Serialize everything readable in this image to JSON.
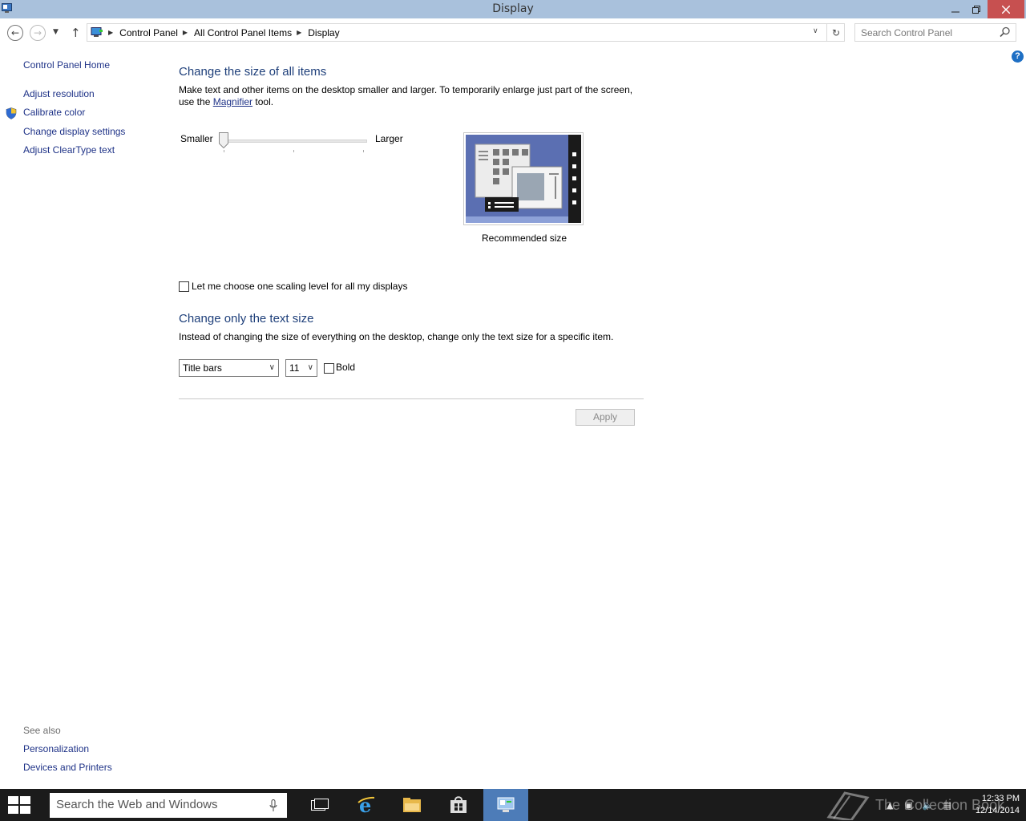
{
  "window": {
    "title": "Display",
    "minimize_icon": "minimize-icon",
    "maximize_icon": "restore-icon",
    "close_icon": "close-icon"
  },
  "navbar": {
    "breadcrumbs": [
      "Control Panel",
      "All Control Panel Items",
      "Display"
    ],
    "search_placeholder": "Search Control Panel"
  },
  "sidebar": {
    "home": "Control Panel Home",
    "items": [
      {
        "label": "Adjust resolution"
      },
      {
        "label": "Calibrate color"
      },
      {
        "label": "Change display settings"
      },
      {
        "label": "Adjust ClearType text"
      }
    ],
    "see_also_label": "See also",
    "see_also": [
      {
        "label": "Personalization"
      },
      {
        "label": "Devices and Printers"
      }
    ]
  },
  "main": {
    "heading_size": "Change the size of all items",
    "desc_line1": "Make text and other items on the desktop smaller and larger. To temporarily enlarge just part of the screen,",
    "desc_line2_prefix": "use the ",
    "magnifier_link": "Magnifier",
    "desc_line2_suffix": " tool.",
    "slider_smaller": "Smaller",
    "slider_larger": "Larger",
    "slider_value": 0,
    "preview_caption": "Recommended size",
    "scaling_checkbox_label": "Let me choose one scaling level for all my displays",
    "scaling_checked": false,
    "heading_text": "Change only the text size",
    "text_desc": "Instead of changing the size of everything on the desktop, change only the text size for a specific item.",
    "item_select": "Title bars",
    "size_select": "11",
    "bold_label": "Bold",
    "bold_checked": false,
    "apply_label": "Apply"
  },
  "taskbar": {
    "search_placeholder": "Search the Web and Windows",
    "time": "12:33 PM",
    "date": "12/14/2014",
    "watermark": "The Collection Book"
  },
  "colors": {
    "titlebar": "#a9c1dc",
    "link": "#1e3287",
    "heading": "#1e3f7a",
    "taskbar": "#1b1b1b",
    "close": "#c75050"
  }
}
